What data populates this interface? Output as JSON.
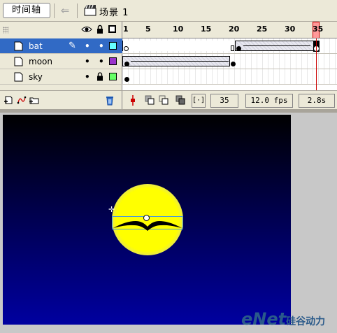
{
  "topbar": {
    "timeline_button": "时间轴",
    "scene_label": "场景 1"
  },
  "layers": [
    {
      "name": "bat",
      "selected": true,
      "color": "#66ffff",
      "locked": false
    },
    {
      "name": "moon",
      "selected": false,
      "color": "#9933cc",
      "locked": false
    },
    {
      "name": "sky",
      "selected": false,
      "color": "#66ff66",
      "locked": true
    }
  ],
  "ruler": {
    "labels": [
      "1",
      "5",
      "10",
      "15",
      "20",
      "25",
      "30",
      "35"
    ],
    "current_frame": "35"
  },
  "status": {
    "frame": "35",
    "fps": "12.0 fps",
    "time": "2.8s"
  },
  "stage": {
    "sky_colors": [
      "#000000",
      "#00004a",
      "#0000a0"
    ],
    "moon_color": "#ffff00"
  },
  "watermark": {
    "brand": "eNet",
    "cn": "硅谷动力"
  }
}
